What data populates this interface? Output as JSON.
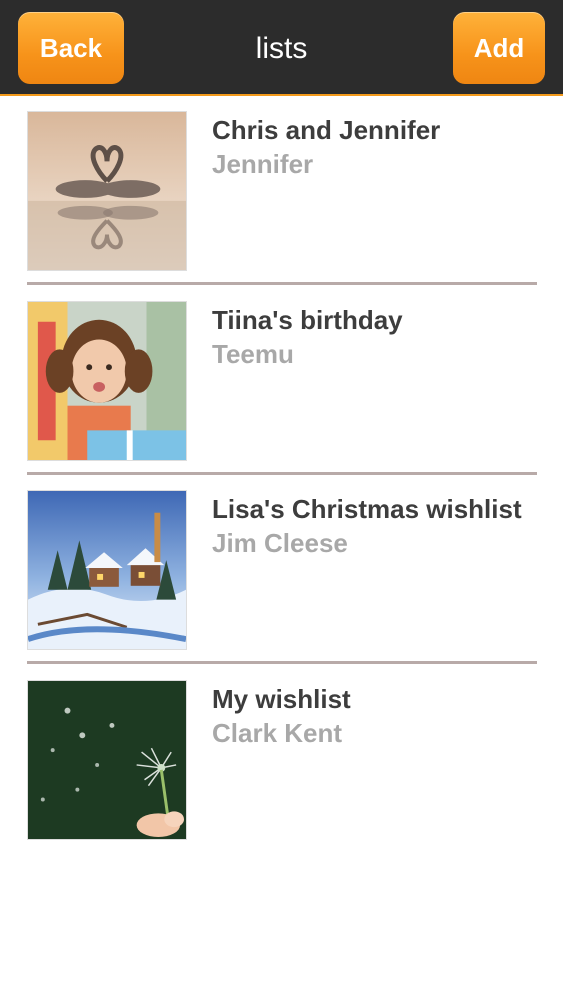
{
  "header": {
    "title": "lists",
    "back_label": "Back",
    "add_label": "Add",
    "accent_color": "#f7931a"
  },
  "lists": [
    {
      "name": "Chris and Jennifer",
      "owner": "Jennifer",
      "image_icon": "swans-heart-image"
    },
    {
      "name": "Tiina's birthday",
      "owner": "Teemu",
      "image_icon": "girl-birthday-image"
    },
    {
      "name": "Lisa's Christmas wishlist",
      "owner": "Jim Cleese",
      "image_icon": "winter-village-image"
    },
    {
      "name": "My wishlist",
      "owner": "Clark Kent",
      "image_icon": "dandelion-image"
    }
  ]
}
